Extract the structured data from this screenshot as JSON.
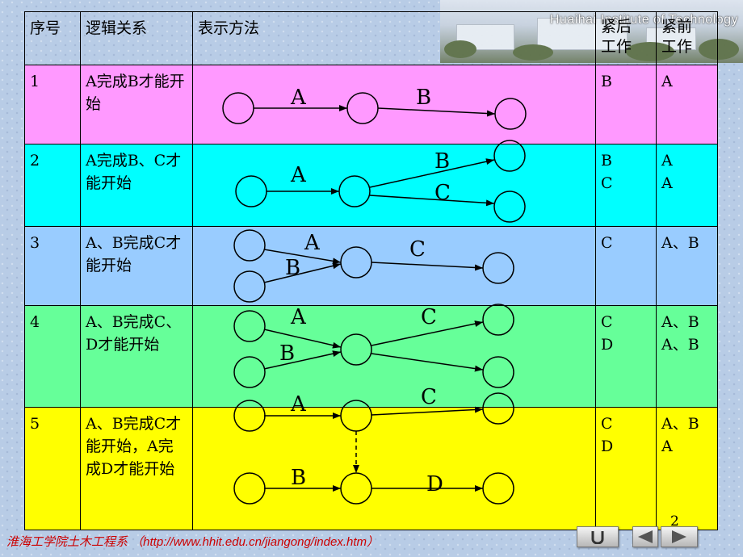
{
  "campus_caption": "Huaihai Institute of Technology",
  "table": {
    "headers": {
      "seq": "序号",
      "logic": "逻辑关系",
      "method": "表示方法",
      "succ": [
        "紧后",
        "工作"
      ],
      "pred": [
        "紧前",
        "工作"
      ]
    },
    "rows": [
      {
        "seq": "1",
        "logic": "A完成B才能开始",
        "succ": "B",
        "pred": "A"
      },
      {
        "seq": "2",
        "logic": "A完成B、C才能开始",
        "succ": "B\nC",
        "pred": "A\nA"
      },
      {
        "seq": "3",
        "logic": "A、B完成C才能开始",
        "succ": "C",
        "pred": "A、B"
      },
      {
        "seq": "4",
        "logic": "A、B完成C、D才能开始",
        "succ": "C\nD",
        "pred": "A、B\nA、B"
      },
      {
        "seq": "5",
        "logic": "A、B完成C才能开始，A完成D才能开始",
        "succ": "C\nD",
        "pred": "A、B\nA"
      }
    ]
  },
  "diagram_labels": {
    "r1": [
      "A",
      "B"
    ],
    "r2": [
      "A",
      "B",
      "C"
    ],
    "r3": [
      "A",
      "B",
      "C"
    ],
    "r4": [
      "A",
      "B",
      "C"
    ],
    "r5": [
      "A",
      "C",
      "B",
      "D"
    ]
  },
  "page_number": "2",
  "footer": "淮海工学院土木工程系 （http://www.hhit.edu.cn/jiangong/index.htm）",
  "nav": {
    "return_icon": "return-icon",
    "prev_icon": "left-triangle-icon",
    "next_icon": "right-triangle-icon"
  },
  "colors": {
    "row1": "#ff99ff",
    "row2": "#00ffff",
    "row3": "#99ccff",
    "row4": "#66ff99",
    "row5": "#ffff00",
    "footer": "#cc0000"
  }
}
